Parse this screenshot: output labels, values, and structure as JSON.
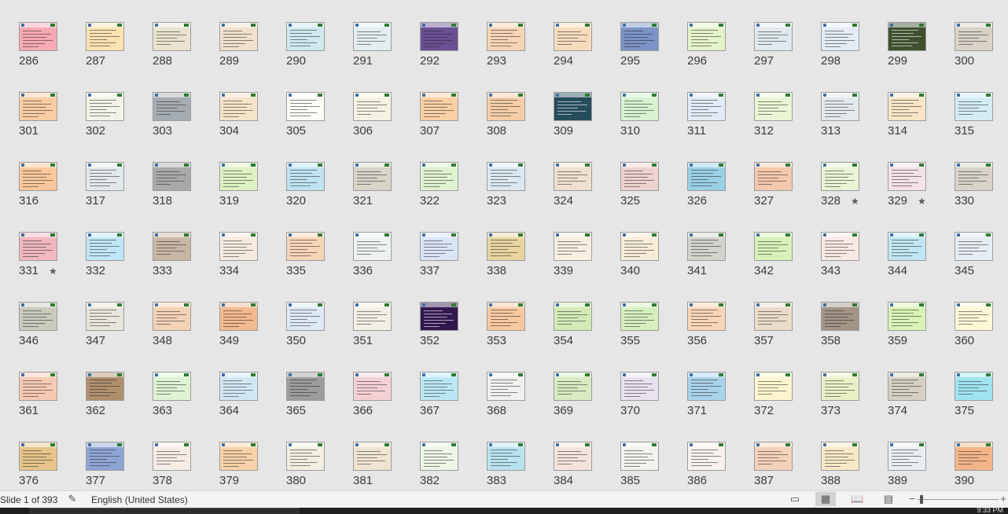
{
  "slide_sorter": {
    "slides": [
      {
        "number": "286",
        "bg": "#f6a9b3"
      },
      {
        "number": "287",
        "bg": "#fbe2b3"
      },
      {
        "number": "288",
        "bg": "#e9e3cf"
      },
      {
        "number": "289",
        "bg": "#f0e0cc"
      },
      {
        "number": "290",
        "bg": "#cfe9ef"
      },
      {
        "number": "291",
        "bg": "#e3edf1"
      },
      {
        "number": "292",
        "bg": "#6a4f93"
      },
      {
        "number": "293",
        "bg": "#f7d4b5"
      },
      {
        "number": "294",
        "bg": "#f6dcbd"
      },
      {
        "number": "295",
        "bg": "#7b93c6"
      },
      {
        "number": "296",
        "bg": "#e4f3c9"
      },
      {
        "number": "297",
        "bg": "#dfe9ee"
      },
      {
        "number": "298",
        "bg": "#e3ecf4"
      },
      {
        "number": "299",
        "bg": "#3f4f2f"
      },
      {
        "number": "300",
        "bg": "#d9d2c7"
      },
      {
        "number": "301",
        "bg": "#f8cda3"
      },
      {
        "number": "302",
        "bg": "#f2f3e6"
      },
      {
        "number": "303",
        "bg": "#a5acb1"
      },
      {
        "number": "304",
        "bg": "#f5e3c8"
      },
      {
        "number": "305",
        "bg": "#fdfdf7"
      },
      {
        "number": "306",
        "bg": "#f6f2e3"
      },
      {
        "number": "307",
        "bg": "#f9cfa5"
      },
      {
        "number": "308",
        "bg": "#f5cda6"
      },
      {
        "number": "309",
        "bg": "#264d5c"
      },
      {
        "number": "310",
        "bg": "#d6f2d0"
      },
      {
        "number": "311",
        "bg": "#e2ecf6"
      },
      {
        "number": "312",
        "bg": "#e9f5d5"
      },
      {
        "number": "313",
        "bg": "#e2e8ec"
      },
      {
        "number": "314",
        "bg": "#f8e5c6"
      },
      {
        "number": "315",
        "bg": "#d3ecf4"
      },
      {
        "number": "316",
        "bg": "#f9c79c"
      },
      {
        "number": "317",
        "bg": "#e2e9ec"
      },
      {
        "number": "318",
        "bg": "#a9a9a9"
      },
      {
        "number": "319",
        "bg": "#dff1c2"
      },
      {
        "number": "320",
        "bg": "#bfe3f1"
      },
      {
        "number": "321",
        "bg": "#d7d4c8"
      },
      {
        "number": "322",
        "bg": "#dff2cf"
      },
      {
        "number": "323",
        "bg": "#dbe8f1"
      },
      {
        "number": "324",
        "bg": "#efe0cf"
      },
      {
        "number": "325",
        "bg": "#eed2d0"
      },
      {
        "number": "326",
        "bg": "#9ad0e6"
      },
      {
        "number": "327",
        "bg": "#f4c8ad"
      },
      {
        "number": "328",
        "bg": "#e7f3d2",
        "star": "★"
      },
      {
        "number": "329",
        "bg": "#f4e2e8",
        "star": "★"
      },
      {
        "number": "330",
        "bg": "#d8d2c8"
      },
      {
        "number": "331",
        "bg": "#f0b7bf",
        "star": "★"
      },
      {
        "number": "332",
        "bg": "#bfe6f6"
      },
      {
        "number": "333",
        "bg": "#c9b7a6"
      },
      {
        "number": "334",
        "bg": "#f6eadf"
      },
      {
        "number": "335",
        "bg": "#f8d4b7"
      },
      {
        "number": "336",
        "bg": "#edf1f1"
      },
      {
        "number": "337",
        "bg": "#d9e4f6"
      },
      {
        "number": "338",
        "bg": "#e9d49f"
      },
      {
        "number": "339",
        "bg": "#f7efe0"
      },
      {
        "number": "340",
        "bg": "#f7ecd7"
      },
      {
        "number": "341",
        "bg": "#d3d2cd"
      },
      {
        "number": "342",
        "bg": "#d8f1b9"
      },
      {
        "number": "343",
        "bg": "#f8e8e3"
      },
      {
        "number": "344",
        "bg": "#bfe6f2"
      },
      {
        "number": "345",
        "bg": "#e5ecf2"
      },
      {
        "number": "346",
        "bg": "#c9c9bc"
      },
      {
        "number": "347",
        "bg": "#e8e6dc"
      },
      {
        "number": "348",
        "bg": "#f3d2b6"
      },
      {
        "number": "349",
        "bg": "#f3b98f"
      },
      {
        "number": "350",
        "bg": "#dde9f5"
      },
      {
        "number": "351",
        "bg": "#f3efe6"
      },
      {
        "number": "352",
        "bg": "#33184f"
      },
      {
        "number": "353",
        "bg": "#f7c89f"
      },
      {
        "number": "354",
        "bg": "#d3eab6"
      },
      {
        "number": "355",
        "bg": "#d6efbf"
      },
      {
        "number": "356",
        "bg": "#f8d5b6"
      },
      {
        "number": "357",
        "bg": "#eadcc9"
      },
      {
        "number": "358",
        "bg": "#a39486"
      },
      {
        "number": "359",
        "bg": "#d9f2b6"
      },
      {
        "number": "360",
        "bg": "#fcf7d4"
      },
      {
        "number": "361",
        "bg": "#f6c9b3"
      },
      {
        "number": "362",
        "bg": "#b08f6c"
      },
      {
        "number": "363",
        "bg": "#def2d4"
      },
      {
        "number": "364",
        "bg": "#d0e7f3"
      },
      {
        "number": "365",
        "bg": "#9c9c9c"
      },
      {
        "number": "366",
        "bg": "#f3d0d4"
      },
      {
        "number": "367",
        "bg": "#bbe7f4"
      },
      {
        "number": "368",
        "bg": "#f0f0ee"
      },
      {
        "number": "369",
        "bg": "#d8eac1"
      },
      {
        "number": "370",
        "bg": "#e8e2ef"
      },
      {
        "number": "371",
        "bg": "#a9d3ea"
      },
      {
        "number": "372",
        "bg": "#fdf5cf"
      },
      {
        "number": "373",
        "bg": "#e9f0c6"
      },
      {
        "number": "374",
        "bg": "#d6d0c2"
      },
      {
        "number": "375",
        "bg": "#9fe3ef"
      },
      {
        "number": "376",
        "bg": "#e6c48a"
      },
      {
        "number": "377",
        "bg": "#8ea5d4"
      },
      {
        "number": "378",
        "bg": "#f6ece6"
      },
      {
        "number": "379",
        "bg": "#f7d2a8"
      },
      {
        "number": "380",
        "bg": "#f2efe1"
      },
      {
        "number": "381",
        "bg": "#efe4d1"
      },
      {
        "number": "382",
        "bg": "#ecf5e7"
      },
      {
        "number": "383",
        "bg": "#b9e3ef"
      },
      {
        "number": "384",
        "bg": "#f4e3dc"
      },
      {
        "number": "385",
        "bg": "#f2f2ec"
      },
      {
        "number": "386",
        "bg": "#f7f0ec"
      },
      {
        "number": "387",
        "bg": "#f3d2b9"
      },
      {
        "number": "388",
        "bg": "#f7e8c6"
      },
      {
        "number": "389",
        "bg": "#e9eef2"
      },
      {
        "number": "390",
        "bg": "#f3b489"
      }
    ]
  },
  "status_bar": {
    "slide_info": "Slide 1 of 393",
    "language": "English (United States)",
    "normal_view_icon": "normal-view-icon",
    "slide_sorter_icon": "slide-sorter-icon",
    "reading_view_icon": "reading-view-icon",
    "slideshow_icon": "slideshow-icon",
    "zoom_out": "−",
    "zoom_in": "+"
  },
  "taskbar": {
    "clock": "9:33 PM"
  }
}
